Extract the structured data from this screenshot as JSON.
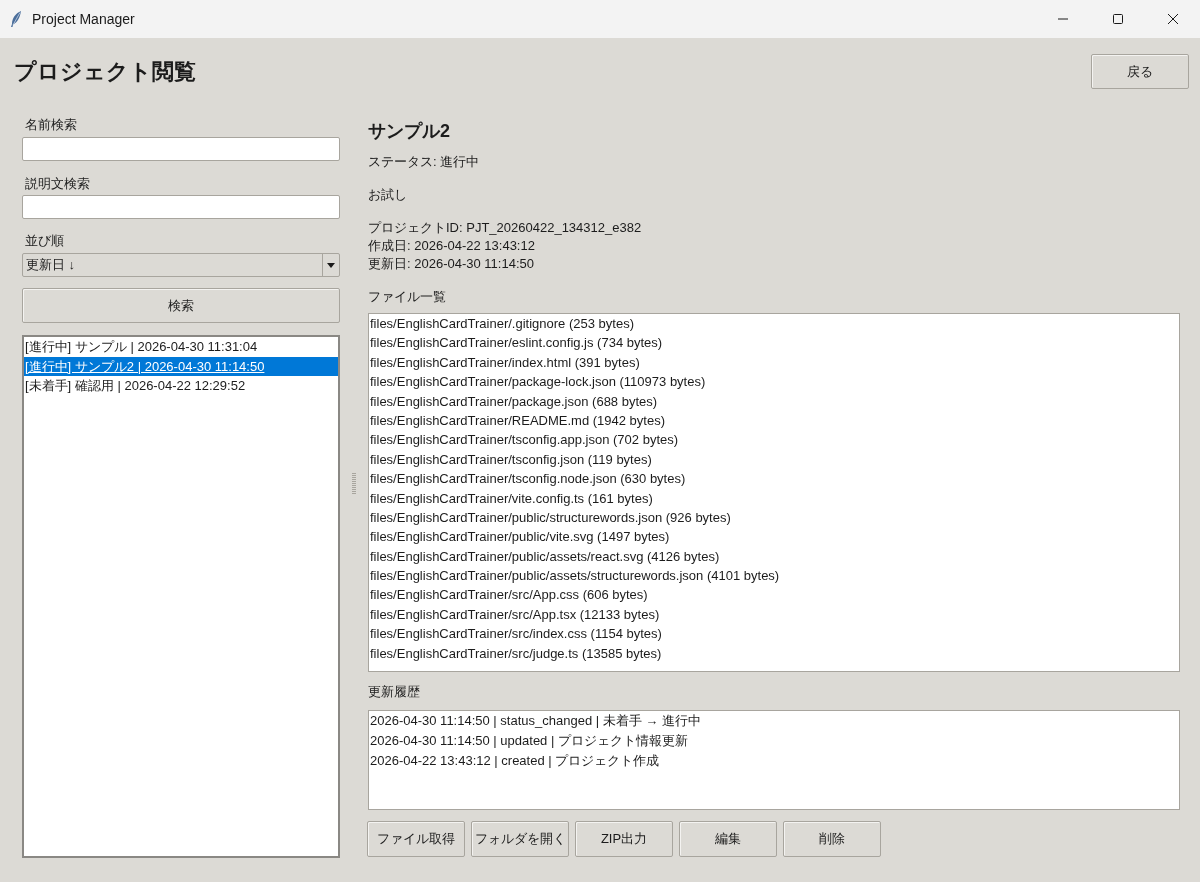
{
  "window": {
    "title": "Project Manager"
  },
  "header": {
    "title": "プロジェクト閲覧",
    "back_button": "戻る"
  },
  "sidebar": {
    "name_search": {
      "label": "名前検索"
    },
    "description_search": {
      "label": "説明文検索"
    },
    "sort": {
      "label": "並び順",
      "value": "更新日 ↓"
    },
    "search_button": "検索",
    "projects": [
      {
        "text": "[進行中] サンプル | 2026-04-30 11:31:04",
        "selected": false
      },
      {
        "text": "[進行中] サンプル2 | 2026-04-30 11:14:50",
        "selected": true
      },
      {
        "text": "[未着手] 確認用 | 2026-04-22 12:29:52",
        "selected": false
      }
    ]
  },
  "detail": {
    "name": "サンプル2",
    "status": "ステータス: 進行中",
    "description": "お試し",
    "meta": [
      "プロジェクトID: PJT_20260422_134312_e382",
      "作成日: 2026-04-22 13:43:12",
      "更新日: 2026-04-30 11:14:50"
    ],
    "files_label": "ファイル一覧",
    "files": [
      "files/EnglishCardTrainer/.gitignore (253 bytes)",
      "files/EnglishCardTrainer/eslint.config.js (734 bytes)",
      "files/EnglishCardTrainer/index.html (391 bytes)",
      "files/EnglishCardTrainer/package-lock.json (110973 bytes)",
      "files/EnglishCardTrainer/package.json (688 bytes)",
      "files/EnglishCardTrainer/README.md (1942 bytes)",
      "files/EnglishCardTrainer/tsconfig.app.json (702 bytes)",
      "files/EnglishCardTrainer/tsconfig.json (119 bytes)",
      "files/EnglishCardTrainer/tsconfig.node.json (630 bytes)",
      "files/EnglishCardTrainer/vite.config.ts (161 bytes)",
      "files/EnglishCardTrainer/public/structurewords.json (926 bytes)",
      "files/EnglishCardTrainer/public/vite.svg (1497 bytes)",
      "files/EnglishCardTrainer/public/assets/react.svg (4126 bytes)",
      "files/EnglishCardTrainer/public/assets/structurewords.json (4101 bytes)",
      "files/EnglishCardTrainer/src/App.css (606 bytes)",
      "files/EnglishCardTrainer/src/App.tsx (12133 bytes)",
      "files/EnglishCardTrainer/src/index.css (1154 bytes)",
      "files/EnglishCardTrainer/src/judge.ts (13585 bytes)"
    ],
    "history_label": "更新履歴",
    "history": [
      "2026-04-30 11:14:50 | status_changed | 未着手 → 進行中",
      "2026-04-30 11:14:50 | updated | プロジェクト情報更新",
      "2026-04-22 13:43:12 | created | プロジェクト作成"
    ],
    "actions": [
      "ファイル取得",
      "フォルダを開く",
      "ZIP出力",
      "編集",
      "削除"
    ]
  }
}
